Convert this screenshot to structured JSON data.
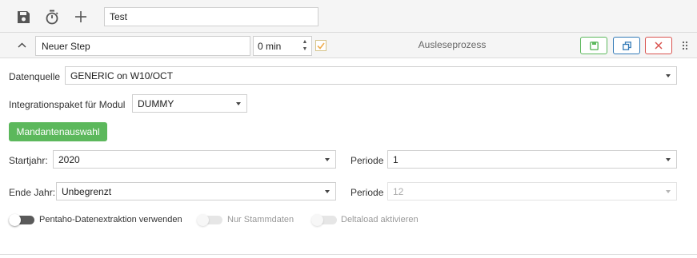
{
  "toolbar": {
    "save_icon": "floppy-disk-icon",
    "timer_icon": "stopwatch-icon",
    "add_icon": "plus-icon",
    "title_value": "Test"
  },
  "step": {
    "collapse_icon": "chevron-up-icon",
    "name_value": "Neuer Step",
    "duration_value": "0 min",
    "checkbox_checked": true,
    "type_label": "Ausleseprozess",
    "buttons": [
      {
        "icon": "save-card-icon",
        "color": "#5cb85c"
      },
      {
        "icon": "copy-icon",
        "color": "#337ab7"
      },
      {
        "icon": "close-icon",
        "color": "#d9534f"
      }
    ],
    "drag_icon": "drag-handle-icon"
  },
  "form": {
    "datenquelle_label": "Datenquelle",
    "datenquelle_value": "GENERIC on W10/OCT",
    "integration_label": "Integrationspaket für Modul",
    "integration_value": "DUMMY",
    "mandanten_button": "Mandantenauswahl",
    "startjahr_label": "Startjahr:",
    "startjahr_value": "2020",
    "periode1_label": "Periode",
    "periode1_value": "1",
    "endejahr_label": "Ende Jahr:",
    "endejahr_value": "Unbegrenzt",
    "periode2_label": "Periode",
    "periode2_value": "12"
  },
  "toggles": [
    {
      "label": "Pentaho-Datenextraktion verwenden",
      "on": false,
      "disabled": false
    },
    {
      "label": "Nur Stammdaten",
      "on": false,
      "disabled": true
    },
    {
      "label": "Deltaload aktivieren",
      "on": false,
      "disabled": true
    }
  ],
  "colors": {
    "accent_green": "#5cb85c",
    "accent_blue": "#337ab7",
    "accent_red": "#d9534f",
    "checkbox_check": "#f0ad4e"
  }
}
